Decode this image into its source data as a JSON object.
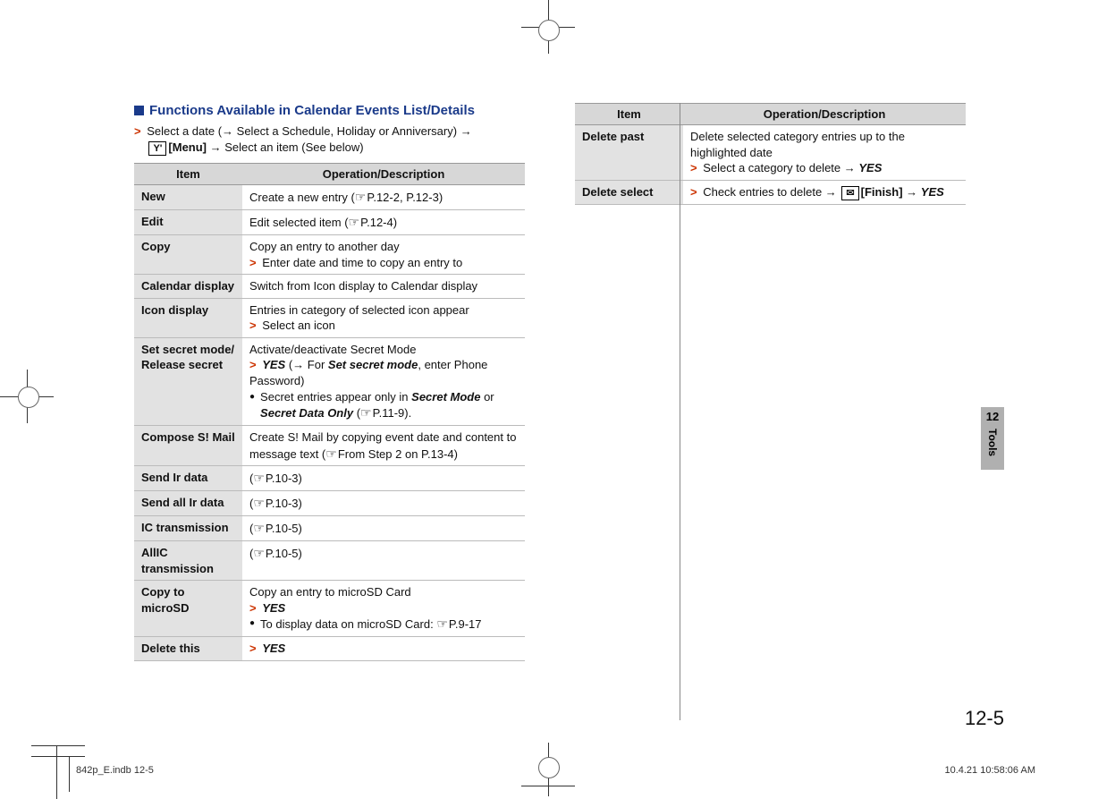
{
  "heading": "Functions Available in Calendar Events List/Details",
  "intro_line1_prefix": "Select a date (",
  "intro_line1_mid": " Select a Schedule, Holiday or Anniversary) ",
  "intro_key_label": "[Menu]",
  "intro_key_icon": "Y'",
  "intro_suffix": " Select an item (See below)",
  "arrow": "→",
  "chevron": ">",
  "table_headers": {
    "item": "Item",
    "desc": "Operation/Description"
  },
  "left_rows": [
    {
      "item": "New",
      "desc_html": "Create a new entry (<span class='ref'></span>P.12-2, P.12-3)"
    },
    {
      "item": "Edit",
      "desc_html": "Edit selected item (<span class='ref'></span>P.12-4)"
    },
    {
      "item": "Copy",
      "desc_html": "Copy an entry to another day<br><span class='gt'>&gt;</span> Enter date and time to copy an entry to"
    },
    {
      "item": "Calendar display",
      "desc_html": "Switch from Icon display to Calendar display"
    },
    {
      "item": "Icon display",
      "desc_html": "Entries in category of selected icon appear<br><span class='gt'>&gt;</span> Select an icon"
    },
    {
      "item": "Set secret mode/ Release secret",
      "desc_html": "Activate/deactivate Secret Mode<br><span class='gt'>&gt;</span> <span class='bi'>YES</span> (→ For <span class='bi'>Set secret mode</span>, enter Phone Password)<br><div class='bullet-row'><span class='bullet-dot'>●</span><span>Secret entries appear only in <span class='bi'>Secret Mode</span> or <span class='bi'>Secret Data Only</span> (<span class='ref'></span>P.11-9).</span></div>"
    },
    {
      "item": "Compose S! Mail",
      "desc_html": "Create S! Mail by copying event date and content to message text (<span class='ref'></span>From Step 2 on P.13-4)"
    },
    {
      "item": "Send Ir data",
      "desc_html": "(<span class='ref'></span>P.10-3)"
    },
    {
      "item": "Send all Ir data",
      "desc_html": "(<span class='ref'></span>P.10-3)"
    },
    {
      "item": "IC transmission",
      "desc_html": "(<span class='ref'></span>P.10-5)"
    },
    {
      "item": "AllIC transmission",
      "desc_html": "(<span class='ref'></span>P.10-5)"
    },
    {
      "item": "Copy to microSD",
      "desc_html": "Copy an entry to microSD Card<br><span class='gt'>&gt;</span> <span class='bi'>YES</span><br><div class='bullet-row'><span class='bullet-dot'>●</span><span>To display data on microSD Card: <span class='ref'></span>P.9-17</span></div>"
    },
    {
      "item": "Delete this",
      "desc_html": "<span class='gt'>&gt;</span> <span class='bi'>YES</span>"
    }
  ],
  "right_rows": [
    {
      "item": "Delete past",
      "desc_html": "Delete selected category entries up to the highlighted date<br><span class='gt'>&gt;</span> Select a category to delete → <span class='bi'>YES</span>"
    },
    {
      "item": "Delete select",
      "desc_html": "<span class='gt'>&gt;</span> Check entries to delete → <span class='boxkey'>✉</span><b>[Finish]</b> → <span class='bi'>YES</span>"
    }
  ],
  "side_tab": {
    "num": "12",
    "label": "Tools"
  },
  "page_number": "12-5",
  "footer_left": "842p_E.indb   12-5",
  "footer_right": "10.4.21   10:58:06 AM"
}
